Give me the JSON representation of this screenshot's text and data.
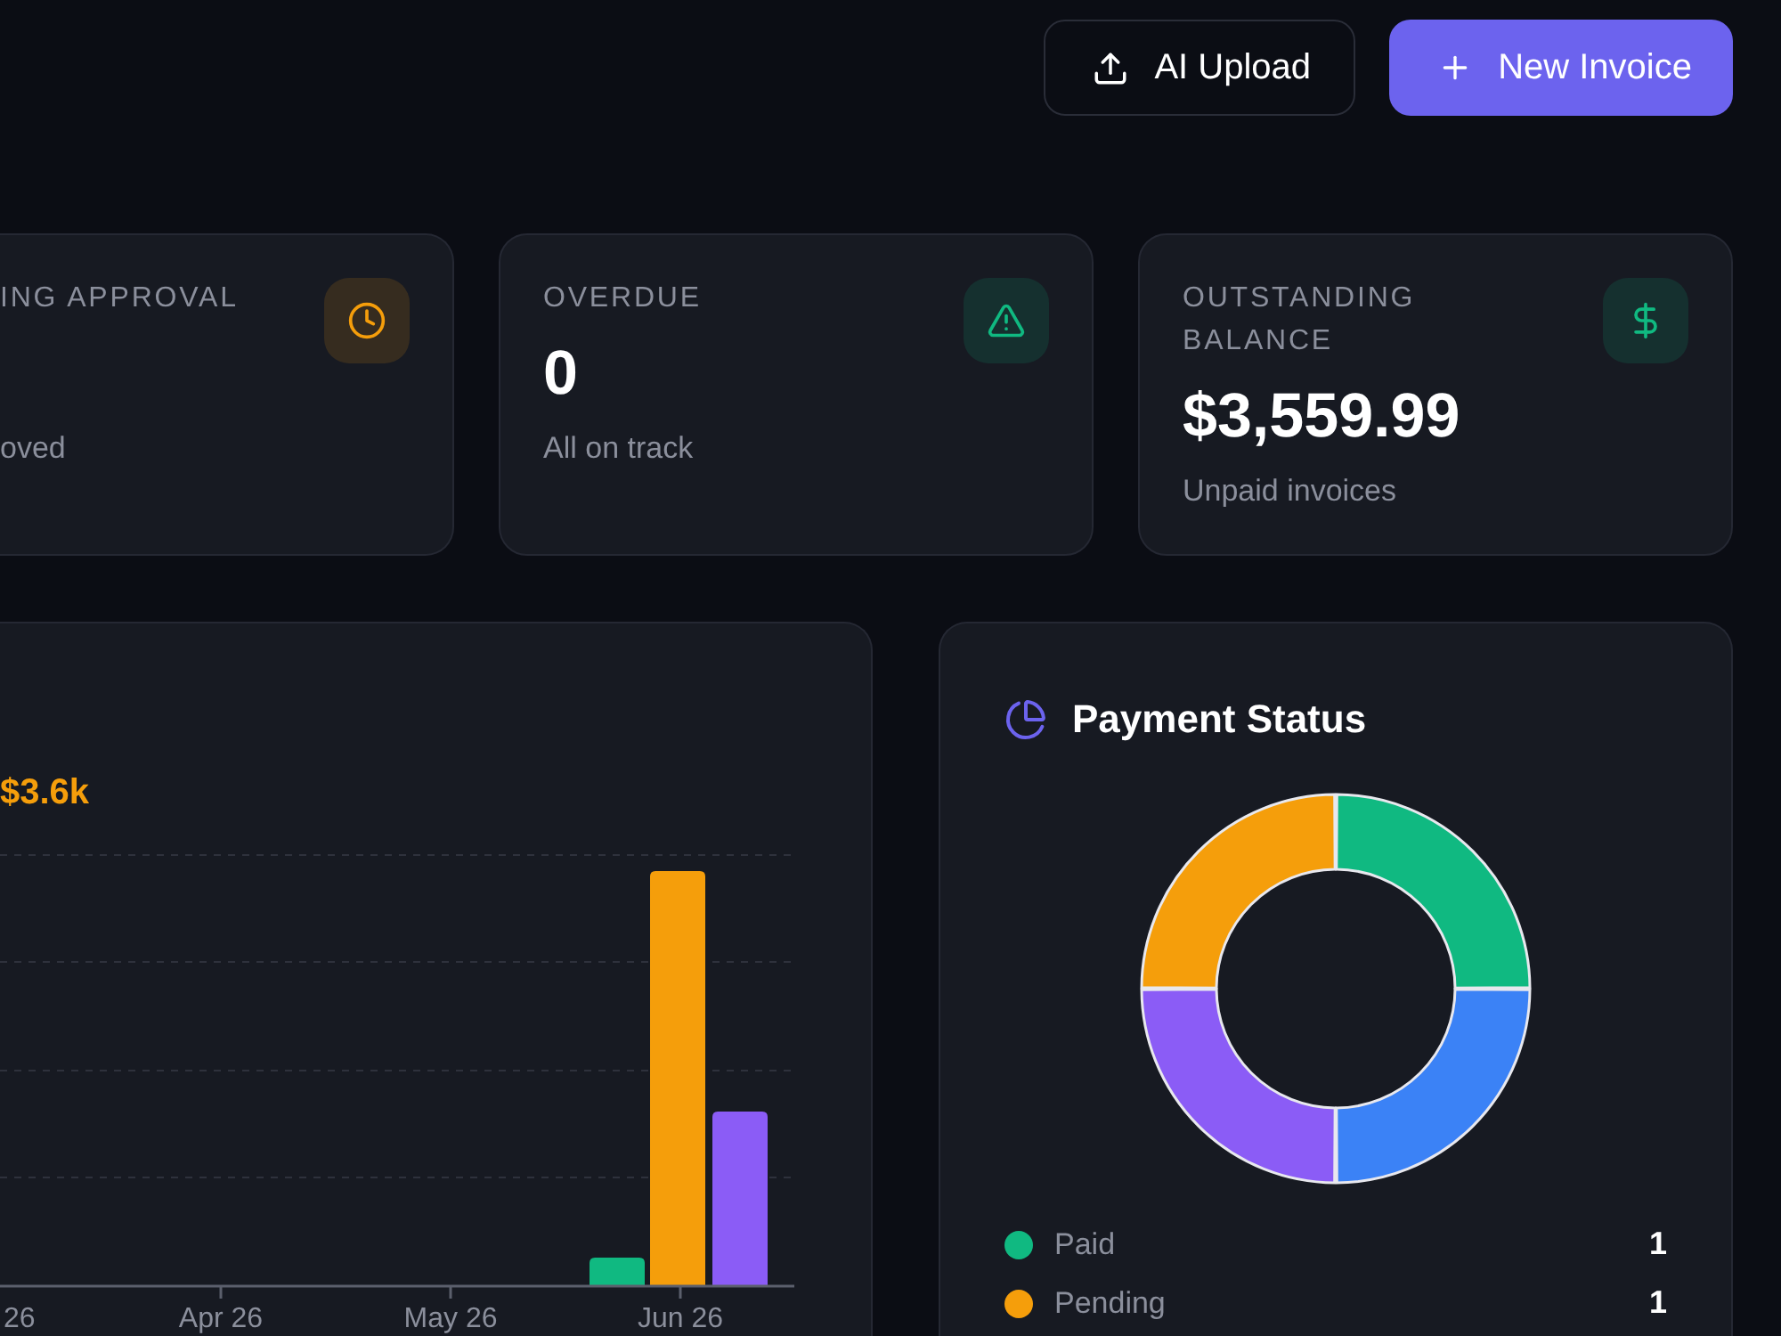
{
  "header_actions": [
    {
      "kind": "outline",
      "label": "AI Upload"
    },
    {
      "kind": "primary",
      "label": "New Invoice"
    }
  ],
  "stat_cards": [
    {
      "label": "ING APPROVAL",
      "subtext": "oved",
      "color": "#f59e0b"
    },
    {
      "label": "OVERDUE",
      "value": "0",
      "subtext": "All on track",
      "color": "#10b981"
    },
    {
      "label": "OUTSTANDING BALANCE",
      "value": "$3,559.99",
      "subtext": "Unpaid invoices",
      "color": "#10b981"
    }
  ],
  "trend_chart": {
    "highlight_value": "$3.6k",
    "x_labels": [
      "26",
      "Apr 26",
      "May 26",
      "Jun 26"
    ]
  },
  "payment_status": {
    "title": "Payment Status",
    "slices": [
      {
        "color": "#10b981"
      },
      {
        "color": "#3b82f6"
      },
      {
        "color": "#8b5cf6"
      },
      {
        "color": "#f59e0b"
      }
    ],
    "legend": [
      {
        "label": "Paid",
        "count": "1",
        "color": "#10b981"
      },
      {
        "label": "Pending",
        "count": "1",
        "color": "#f59e0b"
      }
    ]
  }
}
